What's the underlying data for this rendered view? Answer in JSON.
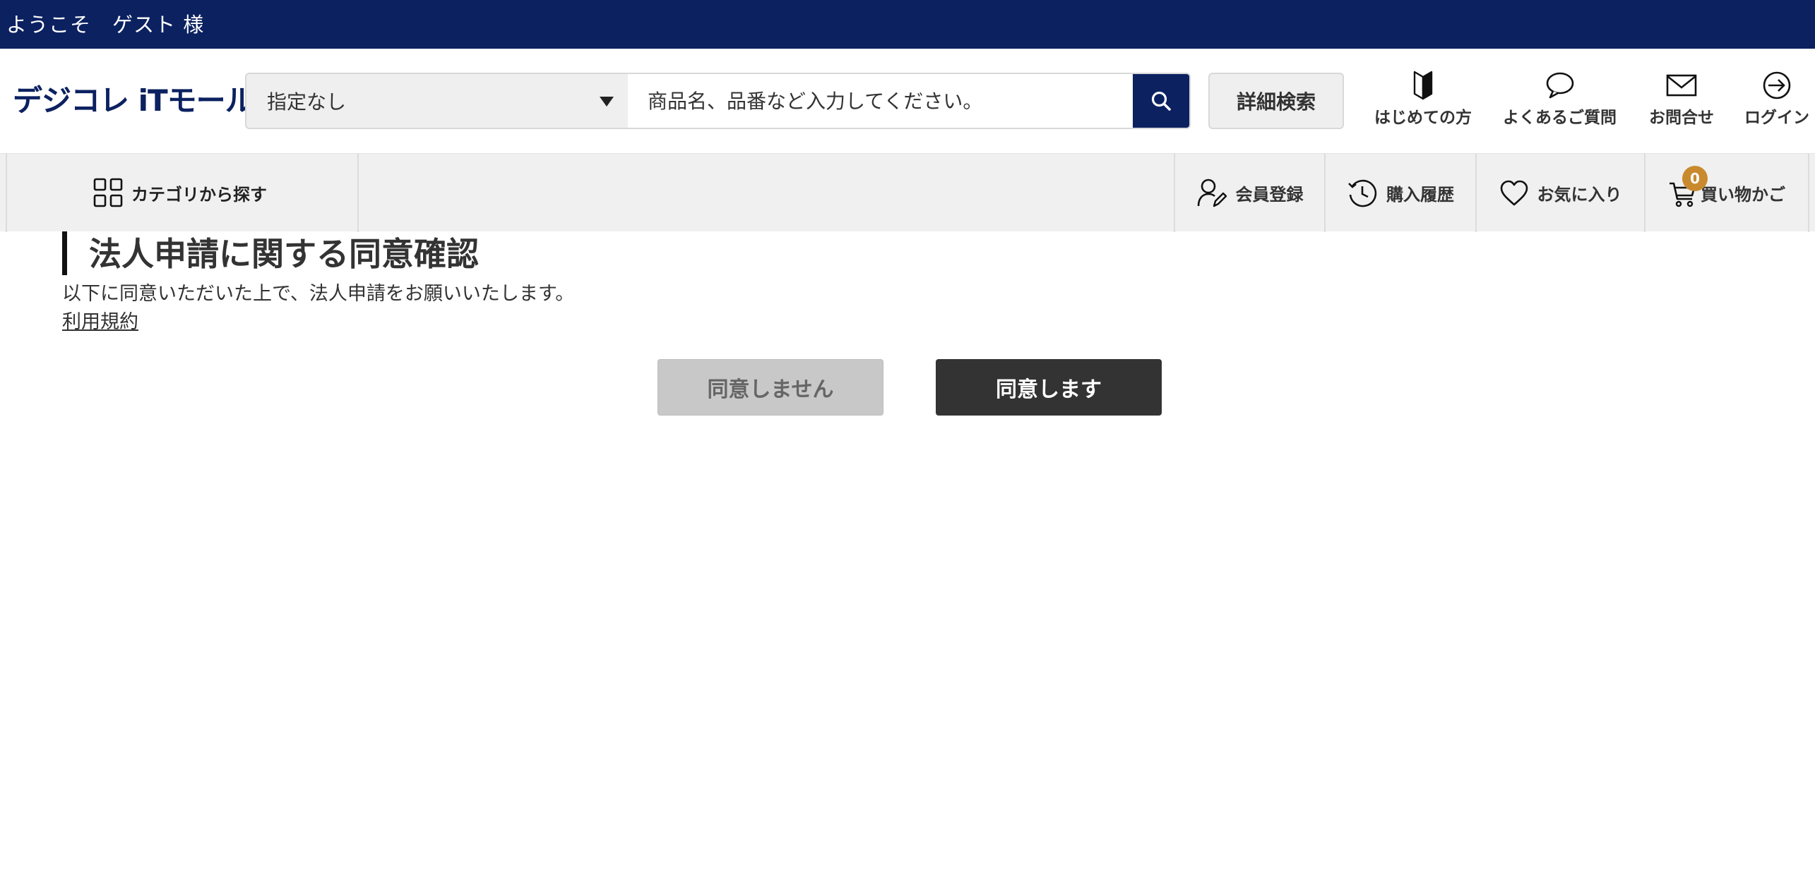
{
  "topbar": {
    "welcome": "ようこそ　ゲスト 様"
  },
  "header": {
    "logo": "デジコレ iTモール",
    "search": {
      "category_selected": "指定なし",
      "placeholder": "商品名、品番など入力してください。",
      "value": ""
    },
    "advanced_search_label": "詳細検索",
    "links": [
      {
        "label": "はじめての方",
        "icon": "beginner-mark-icon"
      },
      {
        "label": "よくあるご質問",
        "icon": "speech-bubble-icon"
      },
      {
        "label": "お問合せ",
        "icon": "mail-icon"
      },
      {
        "label": "ログイン",
        "icon": "login-icon"
      }
    ]
  },
  "navbar": {
    "category_label": "カテゴリから探す",
    "items": [
      {
        "label": "会員登録",
        "icon": "member-register-icon"
      },
      {
        "label": "購入履歴",
        "icon": "history-icon"
      },
      {
        "label": "お気に入り",
        "icon": "heart-icon"
      },
      {
        "label": "買い物かご",
        "icon": "cart-icon"
      }
    ],
    "cart_count": "0"
  },
  "content": {
    "title": "法人申請に関する同意確認",
    "description": "以下に同意いただいた上で、法人申請をお願いいたします。",
    "terms_link": "利用規約",
    "disagree_label": "同意しません",
    "agree_label": "同意します"
  },
  "colors": {
    "brand_navy": "#0b2160",
    "badge": "#c98a2e",
    "agree_button": "#333333",
    "disagree_button": "#c8c8c8"
  }
}
